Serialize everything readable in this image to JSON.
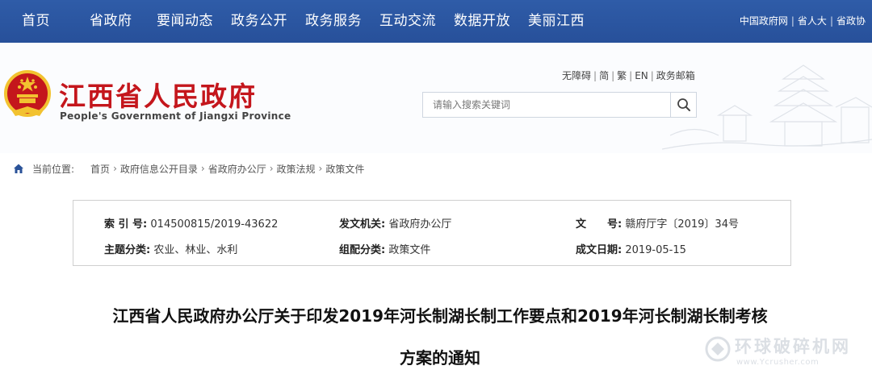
{
  "nav": {
    "items": [
      "首页",
      "省政府",
      "要闻动态",
      "政务公开",
      "政务服务",
      "互动交流",
      "数据开放",
      "美丽江西"
    ],
    "right_links": [
      "中国政府网",
      "省人大",
      "省政协"
    ]
  },
  "header": {
    "site_title": "江西省人民政府",
    "site_subtitle": "People's Government of Jiangxi Province",
    "util_links": [
      "无障碍",
      "简",
      "繁",
      "EN",
      "政务邮箱"
    ],
    "search_placeholder": "请输入搜索关键词"
  },
  "breadcrumb": {
    "label": "当前位置:",
    "items": [
      "首页",
      "政府信息公开目录",
      "省政府办公厅",
      "政策法规",
      "政策文件"
    ]
  },
  "info": {
    "index_label": "索 引 号:",
    "index_value": "014500815/2019-43622",
    "issuer_label": "发文机关:",
    "issuer_value": "省政府办公厅",
    "docno_label": "文　　号:",
    "docno_value": "赣府厅字〔2019〕34号",
    "topic_label": "主题分类:",
    "topic_value": "农业、林业、水利",
    "category_label": "组配分类:",
    "category_value": "政策文件",
    "date_label": "成文日期:",
    "date_value": "2019-05-15"
  },
  "document": {
    "title_line1": "江西省人民政府办公厅关于印发2019年河长制湖长制工作要点和2019年河长制湖长制考核",
    "title_line2": "方案的通知"
  },
  "watermark": {
    "text_cn": "环球破碎机网",
    "text_en": "www.Ycrusher.com"
  },
  "colors": {
    "nav_bg": "#2a5298",
    "title_red": "#c4161c",
    "emblem_gold": "#f2c230"
  }
}
